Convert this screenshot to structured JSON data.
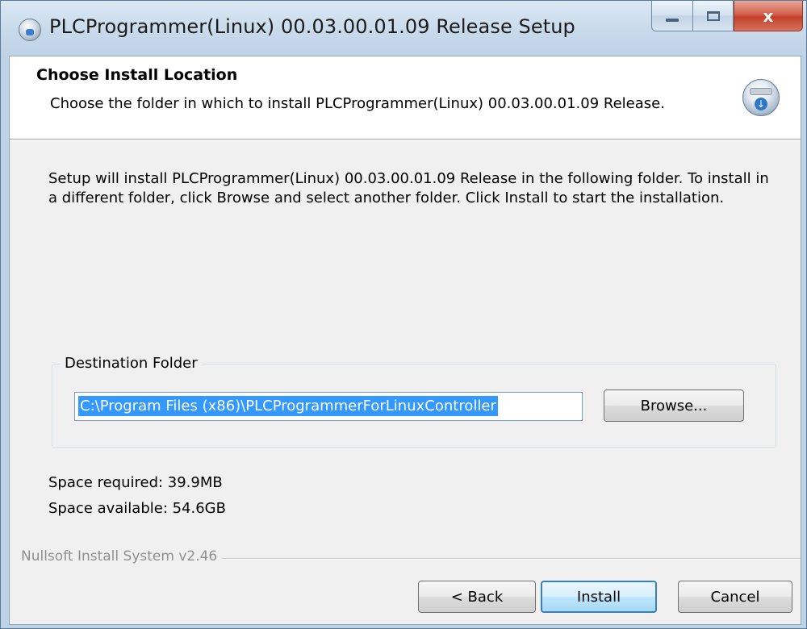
{
  "window": {
    "title": "PLCProgrammer(Linux) 00.03.00.01.09 Release Setup",
    "controls": {
      "close_glyph": "x"
    }
  },
  "header": {
    "title": "Choose Install Location",
    "subtitle": "Choose the folder in which to install PLCProgrammer(Linux) 00.03.00.01.09 Release.",
    "icon": "installer-disc-icon"
  },
  "body": {
    "description": "Setup will install PLCProgrammer(Linux) 00.03.00.01.09 Release in the following folder. To install in a different folder, click Browse and select another folder. Click Install to start the installation.",
    "destination": {
      "legend": "Destination Folder",
      "path": "C:\\Program Files (x86)\\PLCProgrammerForLinuxController",
      "browse_label": "Browse..."
    },
    "space_required": "Space required: 39.9MB",
    "space_available": "Space available: 54.6GB"
  },
  "footer": {
    "branding": "Nullsoft Install System v2.46",
    "back_label": "< Back",
    "install_label": "Install",
    "cancel_label": "Cancel"
  },
  "colors": {
    "selection": "#3399ff",
    "default_button_border": "#3c7fb1",
    "close_button": "#c2402a"
  }
}
